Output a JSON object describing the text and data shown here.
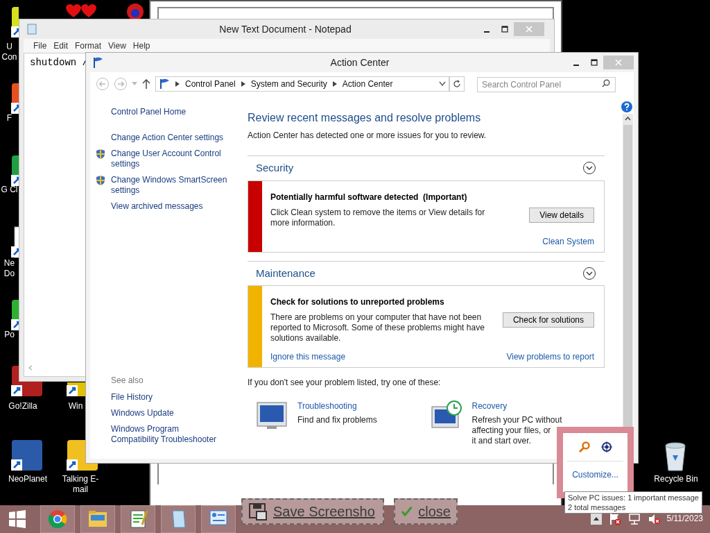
{
  "desktop_icons": [
    {
      "label": "U Con",
      "kind": "app"
    },
    {
      "label": "F",
      "kind": "app"
    },
    {
      "label": "G Cl",
      "kind": "app"
    },
    {
      "label": "Ne Do",
      "kind": "doc"
    },
    {
      "label": "Po",
      "kind": "app"
    },
    {
      "label": "Go!Zilla",
      "kind": "app"
    },
    {
      "label": "Win",
      "kind": "app"
    },
    {
      "label": "NeoPlanet",
      "kind": "app"
    },
    {
      "label": "Talking E-mail",
      "kind": "app"
    },
    {
      "label": "Recycle Bin",
      "kind": "bin"
    }
  ],
  "notepad": {
    "title": "New Text Document - Notepad",
    "menu": [
      "File",
      "Edit",
      "Format",
      "View",
      "Help"
    ],
    "content": "shutdown /"
  },
  "action_center": {
    "title": "Action Center",
    "breadcrumb": [
      "Control Panel",
      "System and Security",
      "Action Center"
    ],
    "search": {
      "placeholder": "Search Control Panel"
    },
    "left_links": [
      {
        "text": "Control Panel Home",
        "shield": false
      },
      {
        "text": "Change Action Center settings",
        "shield": false
      },
      {
        "text": "Change User Account Control settings",
        "shield": true
      },
      {
        "text": "Change Windows SmartScreen settings",
        "shield": true
      },
      {
        "text": "View archived messages",
        "shield": false
      }
    ],
    "see_also": {
      "heading": "See also",
      "links": [
        "File History",
        "Windows Update",
        "Windows Program Compatibility Troubleshooter"
      ]
    },
    "heading": "Review recent messages and resolve problems",
    "subheading": "Action Center has detected one or more issues for you to review.",
    "sections": [
      {
        "title": "Security",
        "message": {
          "color": "#c80000",
          "title": "Potentially harmful software detected  (Important)",
          "body": "Click Clean system to remove the items or View details for more information.",
          "button": "View details",
          "right_link": "Clean System"
        }
      },
      {
        "title": "Maintenance",
        "message": {
          "color": "#f0b400",
          "title": "Check for solutions to unreported problems",
          "body": "There are problems on your computer that have not been reported to Microsoft. Some of these problems might have solutions available.",
          "button": "Check for solutions",
          "left_link": "Ignore this message",
          "right_link": "View problems to report"
        }
      }
    ],
    "hint": "If you don't see your problem listed, try one of these:",
    "tools": [
      {
        "kind": "troubleshoot",
        "title": "Troubleshooting",
        "lines": [
          "Find and fix problems"
        ]
      },
      {
        "kind": "recovery",
        "title": "Recovery",
        "lines": [
          "Refresh your PC without",
          "affecting your files, or",
          "it and start over."
        ]
      }
    ]
  },
  "tray_popup": {
    "link": "Customize..."
  },
  "tooltip": {
    "lines": [
      "Solve PC issues: 1 important message",
      "2 total messages"
    ]
  },
  "taskbar": {
    "pins": [
      {
        "kind": "start"
      },
      {
        "kind": "chrome"
      },
      {
        "kind": "explorer"
      },
      {
        "kind": "notepadpp"
      },
      {
        "kind": "notepad"
      },
      {
        "kind": "control-panel"
      }
    ],
    "overlay_buttons": [
      {
        "kind": "save",
        "label": "Save Screensho"
      },
      {
        "kind": "close",
        "label": "close"
      }
    ],
    "clock": "5/11/2023"
  }
}
